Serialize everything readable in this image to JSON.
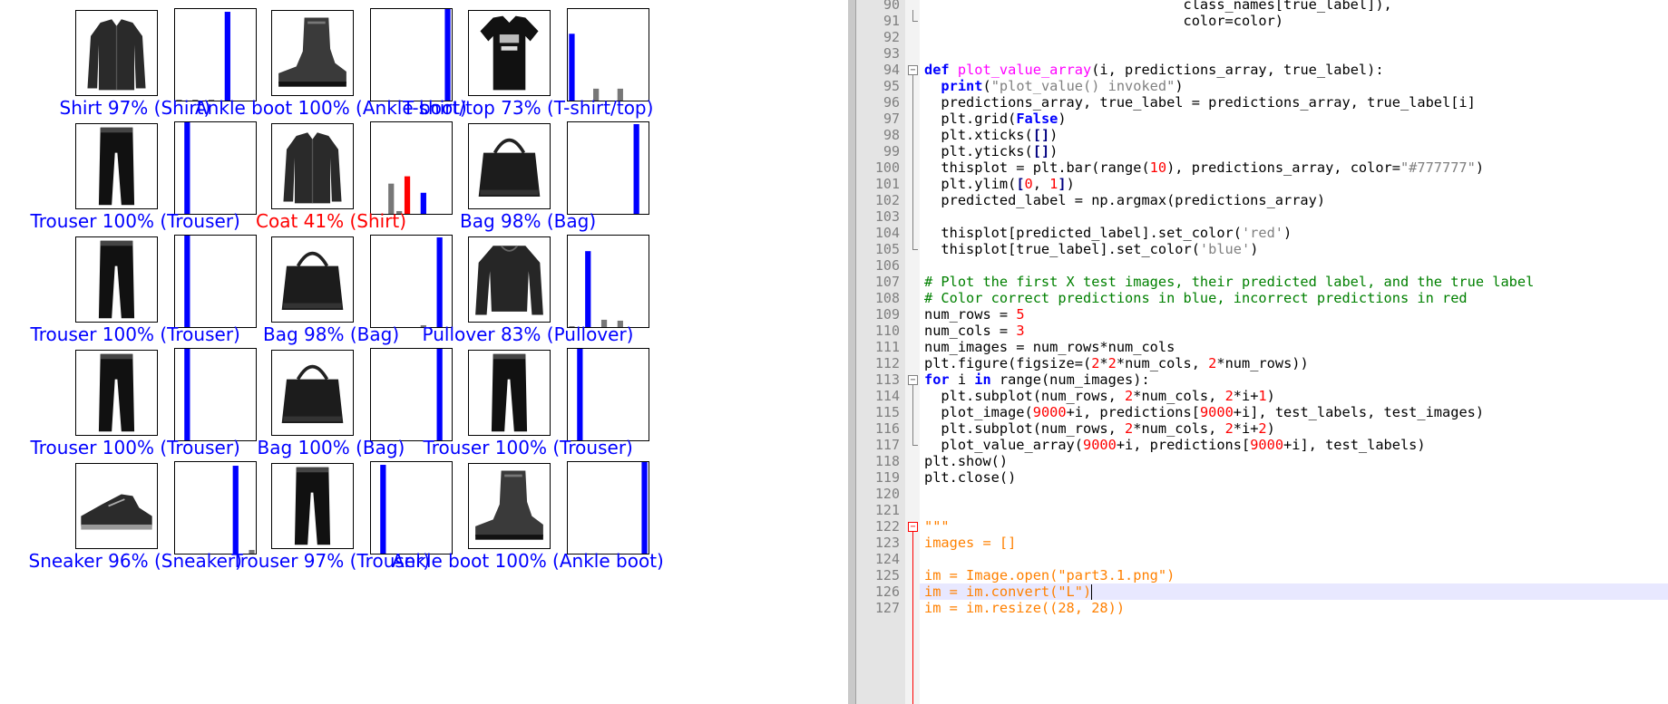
{
  "figure": {
    "panels": [
      {
        "caption": "Shirt 97% (Shirt)",
        "color": "#0000ff",
        "image": "shirt-image",
        "predicted": 6,
        "true": 6,
        "probs": [
          0.01,
          0,
          0.01,
          0,
          0.01,
          0,
          0.97,
          0,
          0,
          0
        ]
      },
      {
        "caption": "Ankle boot 100% (Ankle boot)",
        "color": "#0000ff",
        "image": "ankle-boot-image",
        "predicted": 9,
        "true": 9,
        "probs": [
          0,
          0,
          0,
          0,
          0,
          0,
          0,
          0,
          0,
          1.0
        ]
      },
      {
        "caption": "T-shirt/top 73% (T-shirt/top)",
        "color": "#0000ff",
        "image": "tshirt-image",
        "predicted": 0,
        "true": 0,
        "probs": [
          0.73,
          0,
          0,
          0.13,
          0,
          0,
          0.13,
          0,
          0,
          0
        ]
      },
      {
        "caption": "Trouser 100% (Trouser)",
        "color": "#0000ff",
        "image": "trouser-image",
        "predicted": 1,
        "true": 1,
        "probs": [
          0,
          1.0,
          0,
          0,
          0,
          0,
          0,
          0,
          0,
          0
        ]
      },
      {
        "caption": "Coat 41% (Shirt)",
        "color": "#ff0000",
        "image": "shirt-image",
        "predicted": 4,
        "true": 6,
        "probs": [
          0,
          0,
          0.33,
          0.03,
          0.41,
          0,
          0.23,
          0,
          0,
          0
        ]
      },
      {
        "caption": "Bag 98% (Bag)",
        "color": "#0000ff",
        "image": "bag-image",
        "predicted": 8,
        "true": 8,
        "probs": [
          0,
          0,
          0,
          0,
          0,
          0,
          0,
          0,
          0.98,
          0
        ]
      },
      {
        "caption": "Trouser 100% (Trouser)",
        "color": "#0000ff",
        "image": "trouser-image",
        "predicted": 1,
        "true": 1,
        "probs": [
          0,
          1.0,
          0,
          0,
          0,
          0,
          0,
          0,
          0,
          0
        ]
      },
      {
        "caption": "Bag 98% (Bag)",
        "color": "#0000ff",
        "image": "bag-image",
        "predicted": 8,
        "true": 8,
        "probs": [
          0,
          0,
          0,
          0,
          0,
          0,
          0.02,
          0,
          0.98,
          0
        ]
      },
      {
        "caption": "Pullover 83% (Pullover)",
        "color": "#0000ff",
        "image": "pullover-image",
        "predicted": 2,
        "true": 2,
        "probs": [
          0.01,
          0,
          0.83,
          0,
          0.08,
          0,
          0.07,
          0,
          0,
          0
        ]
      },
      {
        "caption": "Trouser 100% (Trouser)",
        "color": "#0000ff",
        "image": "trouser-image",
        "predicted": 1,
        "true": 1,
        "probs": [
          0,
          1.0,
          0,
          0,
          0,
          0,
          0,
          0,
          0,
          0
        ]
      },
      {
        "caption": "Bag 100% (Bag)",
        "color": "#0000ff",
        "image": "bag-image",
        "predicted": 8,
        "true": 8,
        "probs": [
          0,
          0,
          0,
          0,
          0,
          0,
          0,
          0,
          1.0,
          0
        ]
      },
      {
        "caption": "Trouser 100% (Trouser)",
        "color": "#0000ff",
        "image": "trouser-image",
        "predicted": 1,
        "true": 1,
        "probs": [
          0,
          1.0,
          0,
          0,
          0,
          0,
          0,
          0,
          0,
          0
        ]
      },
      {
        "caption": "Sneaker 96% (Sneaker)",
        "color": "#0000ff",
        "image": "sneaker-image",
        "predicted": 7,
        "true": 7,
        "probs": [
          0,
          0,
          0,
          0,
          0,
          0,
          0,
          0.96,
          0,
          0.04
        ]
      },
      {
        "caption": "Trouser 97% (Trouser)",
        "color": "#0000ff",
        "image": "trouser-image",
        "predicted": 1,
        "true": 1,
        "probs": [
          0,
          0.97,
          0,
          0,
          0,
          0,
          0,
          0,
          0,
          0
        ]
      },
      {
        "caption": "Ankle boot 100% (Ankle boot)",
        "color": "#0000ff",
        "image": "ankle-boot-image",
        "predicted": 9,
        "true": 9,
        "probs": [
          0,
          0,
          0,
          0,
          0,
          0,
          0,
          0,
          0,
          1.0
        ]
      }
    ]
  },
  "editor": {
    "current_line": "126",
    "lines": [
      {
        "n": "90",
        "t": [
          {
            "c": "                               class_names[true_label]),",
            "s": ""
          }
        ]
      },
      {
        "n": "91",
        "t": [
          {
            "c": "                               color=color)",
            "s": ""
          }
        ]
      },
      {
        "n": "92",
        "t": []
      },
      {
        "n": "93",
        "t": []
      },
      {
        "n": "94",
        "t": [
          {
            "c": "def",
            "s": "kw"
          },
          {
            "c": " ",
            "s": ""
          },
          {
            "c": "plot_value_array",
            "s": "fn"
          },
          {
            "c": "(i, predictions_array, true_label):",
            "s": ""
          }
        ]
      },
      {
        "n": "95",
        "t": [
          {
            "c": "  ",
            "s": ""
          },
          {
            "c": "print",
            "s": "kw"
          },
          {
            "c": "(",
            "s": ""
          },
          {
            "c": "\"plot_value() invoked\"",
            "s": "str"
          },
          {
            "c": ")",
            "s": ""
          }
        ]
      },
      {
        "n": "96",
        "t": [
          {
            "c": "  predictions_array, true_label = predictions_array, true_label[i]",
            "s": ""
          }
        ]
      },
      {
        "n": "97",
        "t": [
          {
            "c": "  plt.grid(",
            "s": ""
          },
          {
            "c": "False",
            "s": "kw"
          },
          {
            "c": ")",
            "s": ""
          }
        ]
      },
      {
        "n": "98",
        "t": [
          {
            "c": "  plt.xticks(",
            "s": ""
          },
          {
            "c": "[]",
            "s": "op"
          },
          {
            "c": ")",
            "s": ""
          }
        ]
      },
      {
        "n": "99",
        "t": [
          {
            "c": "  plt.yticks(",
            "s": ""
          },
          {
            "c": "[]",
            "s": "op"
          },
          {
            "c": ")",
            "s": ""
          }
        ]
      },
      {
        "n": "100",
        "t": [
          {
            "c": "  thisplot = plt.bar(range(",
            "s": ""
          },
          {
            "c": "10",
            "s": "num"
          },
          {
            "c": "), predictions_array, color=",
            "s": ""
          },
          {
            "c": "\"#777777\"",
            "s": "str"
          },
          {
            "c": ")",
            "s": ""
          }
        ]
      },
      {
        "n": "101",
        "t": [
          {
            "c": "  plt.ylim(",
            "s": ""
          },
          {
            "c": "[",
            "s": "op"
          },
          {
            "c": "0",
            "s": "num"
          },
          {
            "c": ", ",
            "s": ""
          },
          {
            "c": "1",
            "s": "num"
          },
          {
            "c": "]",
            "s": "op"
          },
          {
            "c": ")",
            "s": ""
          }
        ]
      },
      {
        "n": "102",
        "t": [
          {
            "c": "  predicted_label = np.argmax(predictions_array)",
            "s": ""
          }
        ]
      },
      {
        "n": "103",
        "t": []
      },
      {
        "n": "104",
        "t": [
          {
            "c": "  thisplot[predicted_label].set_color(",
            "s": ""
          },
          {
            "c": "'red'",
            "s": "str"
          },
          {
            "c": ")",
            "s": ""
          }
        ]
      },
      {
        "n": "105",
        "t": [
          {
            "c": "  thisplot[true_label].set_color(",
            "s": ""
          },
          {
            "c": "'blue'",
            "s": "str"
          },
          {
            "c": ")",
            "s": ""
          }
        ]
      },
      {
        "n": "106",
        "t": []
      },
      {
        "n": "107",
        "t": [
          {
            "c": "# Plot the first X test images, their predicted label, and the true label",
            "s": "cm"
          }
        ]
      },
      {
        "n": "108",
        "t": [
          {
            "c": "# Color correct predictions in blue, incorrect predictions in red",
            "s": "cm"
          }
        ]
      },
      {
        "n": "109",
        "t": [
          {
            "c": "num_rows = ",
            "s": ""
          },
          {
            "c": "5",
            "s": "num"
          }
        ]
      },
      {
        "n": "110",
        "t": [
          {
            "c": "num_cols = ",
            "s": ""
          },
          {
            "c": "3",
            "s": "num"
          }
        ]
      },
      {
        "n": "111",
        "t": [
          {
            "c": "num_images = num_rows*num_cols",
            "s": ""
          }
        ]
      },
      {
        "n": "112",
        "t": [
          {
            "c": "plt.figure(figsize=(",
            "s": ""
          },
          {
            "c": "2",
            "s": "num"
          },
          {
            "c": "*",
            "s": ""
          },
          {
            "c": "2",
            "s": "num"
          },
          {
            "c": "*num_cols, ",
            "s": ""
          },
          {
            "c": "2",
            "s": "num"
          },
          {
            "c": "*num_rows))",
            "s": ""
          }
        ]
      },
      {
        "n": "113",
        "t": [
          {
            "c": "for",
            "s": "kw"
          },
          {
            "c": " i ",
            "s": ""
          },
          {
            "c": "in",
            "s": "kw"
          },
          {
            "c": " range(num_images):",
            "s": ""
          }
        ]
      },
      {
        "n": "114",
        "t": [
          {
            "c": "  plt.subplot(num_rows, ",
            "s": ""
          },
          {
            "c": "2",
            "s": "num"
          },
          {
            "c": "*num_cols, ",
            "s": ""
          },
          {
            "c": "2",
            "s": "num"
          },
          {
            "c": "*i+",
            "s": ""
          },
          {
            "c": "1",
            "s": "num"
          },
          {
            "c": ")",
            "s": ""
          }
        ]
      },
      {
        "n": "115",
        "t": [
          {
            "c": "  plot_image(",
            "s": ""
          },
          {
            "c": "9000",
            "s": "num"
          },
          {
            "c": "+i, predictions[",
            "s": ""
          },
          {
            "c": "9000",
            "s": "num"
          },
          {
            "c": "+i], test_labels, test_images)",
            "s": ""
          }
        ]
      },
      {
        "n": "116",
        "t": [
          {
            "c": "  plt.subplot(num_rows, ",
            "s": ""
          },
          {
            "c": "2",
            "s": "num"
          },
          {
            "c": "*num_cols, ",
            "s": ""
          },
          {
            "c": "2",
            "s": "num"
          },
          {
            "c": "*i+",
            "s": ""
          },
          {
            "c": "2",
            "s": "num"
          },
          {
            "c": ")",
            "s": ""
          }
        ]
      },
      {
        "n": "117",
        "t": [
          {
            "c": "  plot_value_array(",
            "s": ""
          },
          {
            "c": "9000",
            "s": "num"
          },
          {
            "c": "+i, predictions[",
            "s": ""
          },
          {
            "c": "9000",
            "s": "num"
          },
          {
            "c": "+i], test_labels)",
            "s": ""
          }
        ]
      },
      {
        "n": "118",
        "t": [
          {
            "c": "plt.show()",
            "s": ""
          }
        ]
      },
      {
        "n": "119",
        "t": [
          {
            "c": "plt.close()",
            "s": ""
          }
        ]
      },
      {
        "n": "120",
        "t": []
      },
      {
        "n": "121",
        "t": []
      },
      {
        "n": "122",
        "t": [
          {
            "c": "\"\"\"",
            "s": "ds"
          }
        ]
      },
      {
        "n": "123",
        "t": [
          {
            "c": "images = []",
            "s": "ds"
          }
        ]
      },
      {
        "n": "124",
        "t": []
      },
      {
        "n": "125",
        "t": [
          {
            "c": "im = Image.open(\"part3.1.png\")",
            "s": "ds"
          }
        ]
      },
      {
        "n": "126",
        "t": [
          {
            "c": "im = im.convert(\"L\")",
            "s": "ds"
          }
        ]
      },
      {
        "n": "127",
        "t": [
          {
            "c": "im = im.resize((28, 28))",
            "s": "ds"
          }
        ]
      }
    ]
  }
}
